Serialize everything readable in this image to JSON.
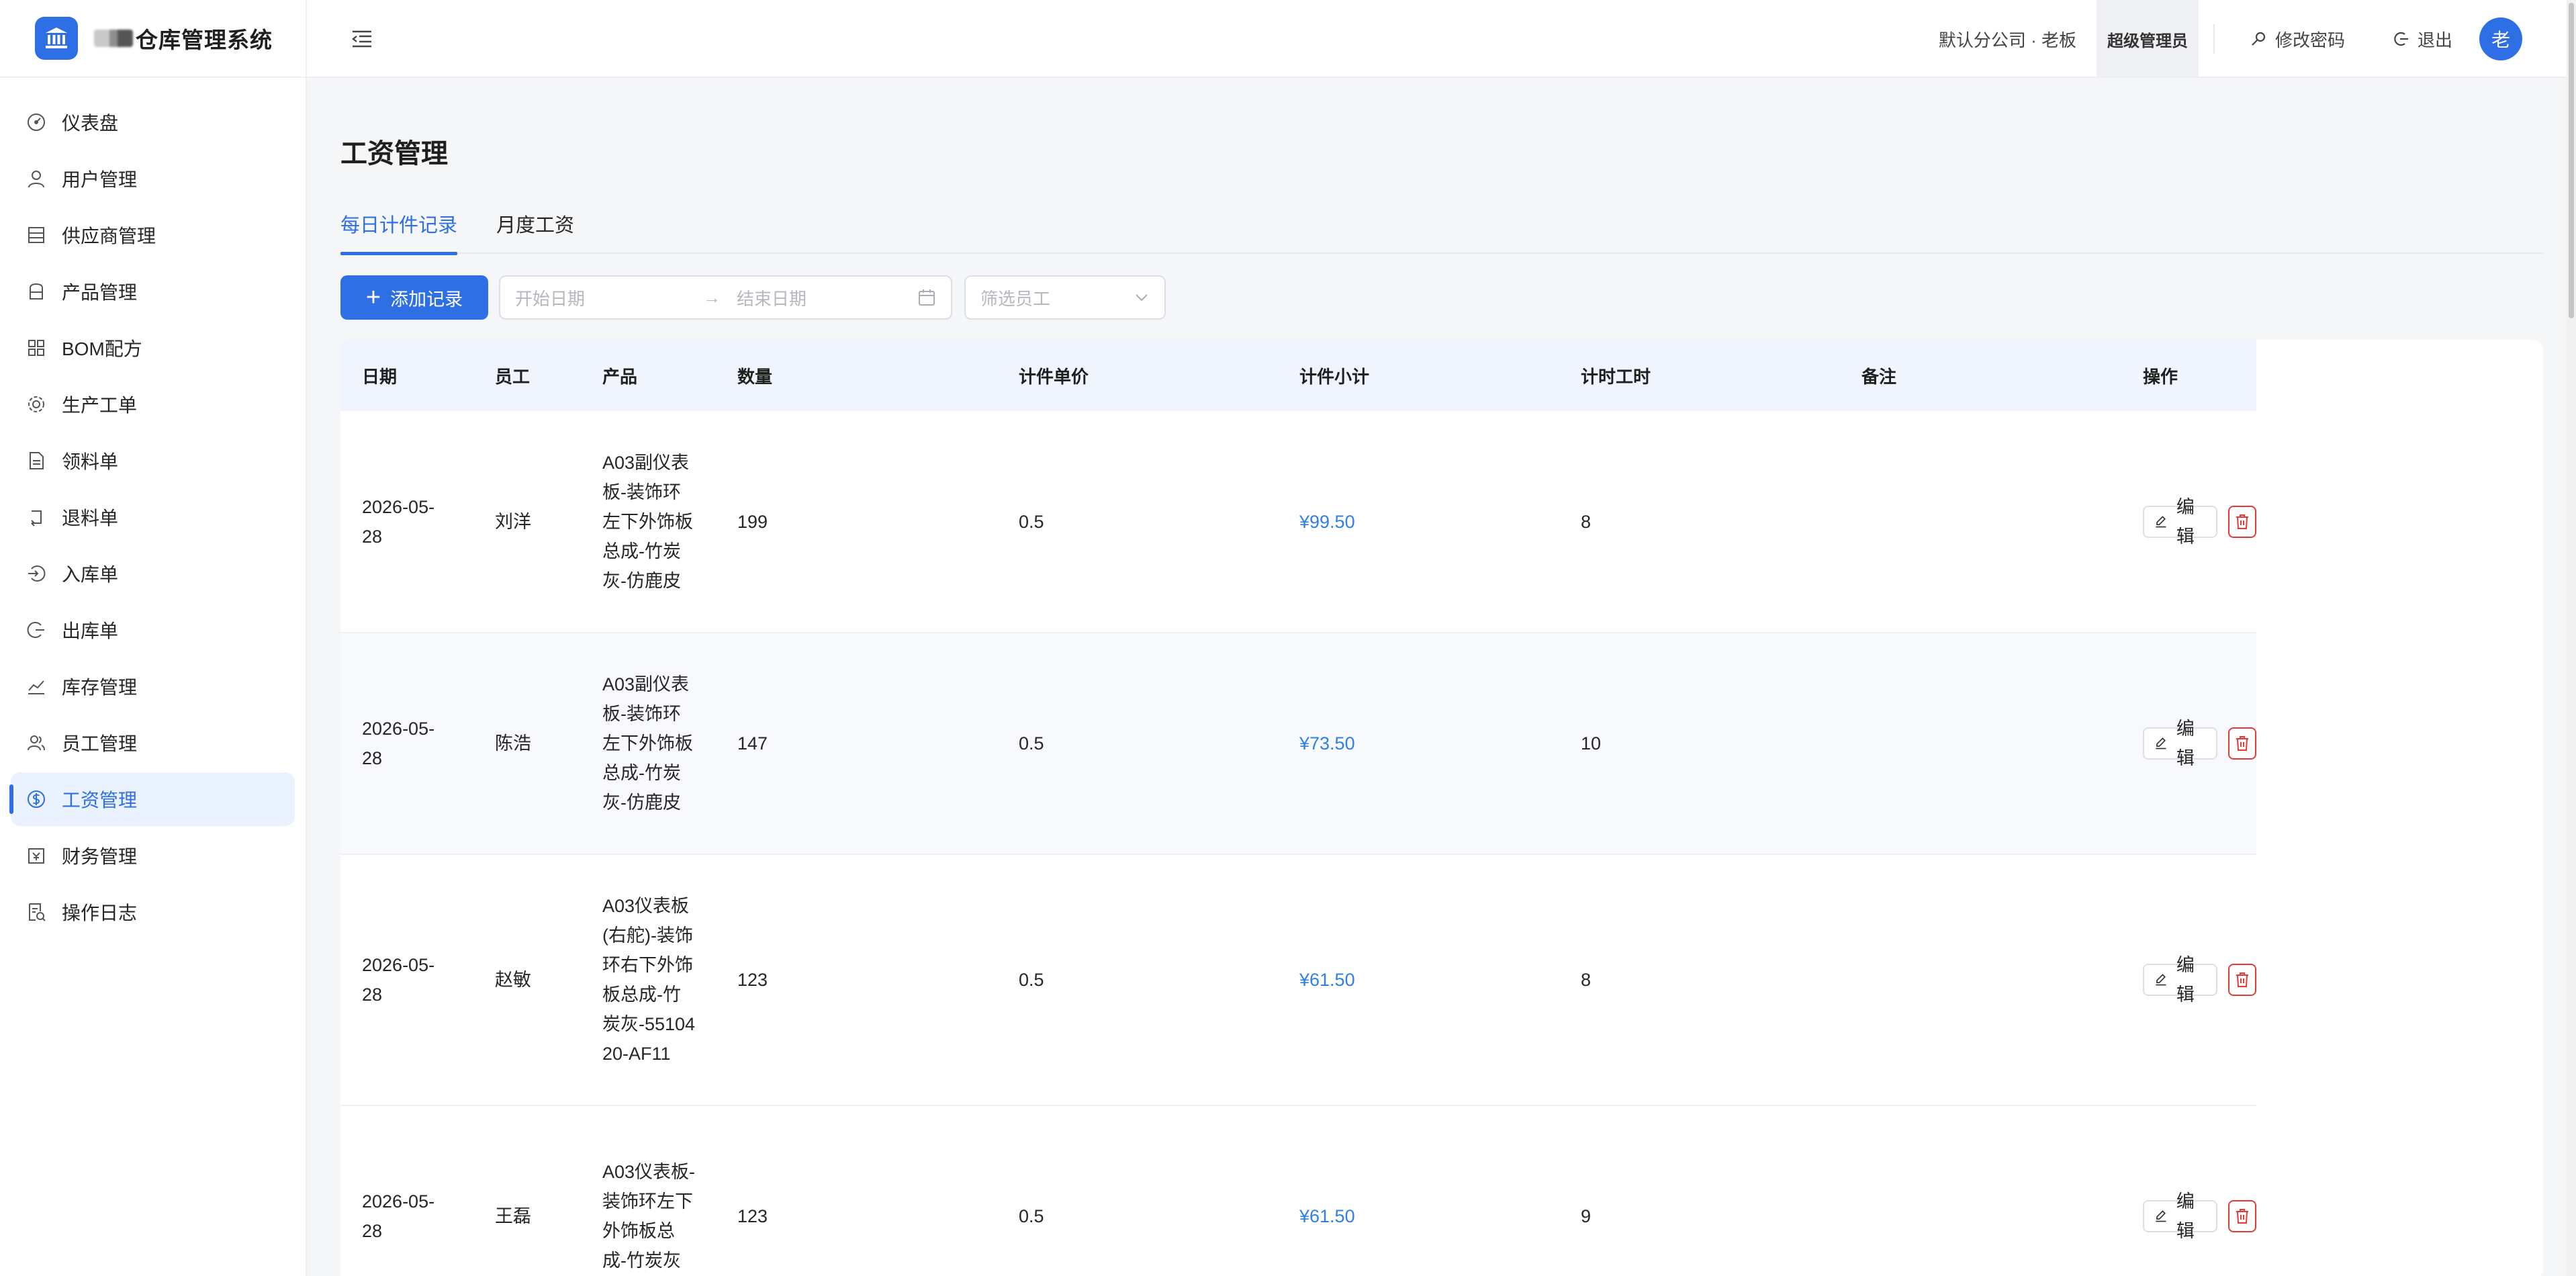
{
  "app": {
    "title": "仓库管理系统"
  },
  "sidebar": {
    "items": [
      {
        "label": "仪表盘",
        "icon": "dashboard-icon",
        "active": false
      },
      {
        "label": "用户管理",
        "icon": "user-icon",
        "active": false
      },
      {
        "label": "供应商管理",
        "icon": "store-icon",
        "active": false
      },
      {
        "label": "产品管理",
        "icon": "box-icon",
        "active": false
      },
      {
        "label": "BOM配方",
        "icon": "grid-icon",
        "active": false
      },
      {
        "label": "生产工单",
        "icon": "gear-icon",
        "active": false
      },
      {
        "label": "领料单",
        "icon": "document-icon",
        "active": false
      },
      {
        "label": "退料单",
        "icon": "return-icon",
        "active": false
      },
      {
        "label": "入库单",
        "icon": "login-icon",
        "active": false
      },
      {
        "label": "出库单",
        "icon": "logout-icon",
        "active": false
      },
      {
        "label": "库存管理",
        "icon": "line-chart-icon",
        "active": false
      },
      {
        "label": "员工管理",
        "icon": "team-icon",
        "active": false
      },
      {
        "label": "工资管理",
        "icon": "dollar-icon",
        "active": true
      },
      {
        "label": "财务管理",
        "icon": "account-book-icon",
        "active": false
      },
      {
        "label": "操作日志",
        "icon": "log-icon",
        "active": false
      }
    ]
  },
  "header": {
    "company": "默认分公司 · 老板",
    "role_badge": "超级管理员",
    "change_password": "修改密码",
    "logout": "退出",
    "avatar_text": "老"
  },
  "page": {
    "title": "工资管理",
    "tabs": [
      {
        "label": "每日计件记录",
        "active": true
      },
      {
        "label": "月度工资",
        "active": false
      }
    ],
    "toolbar": {
      "add_label": "添加记录",
      "start_placeholder": "开始日期",
      "end_placeholder": "结束日期",
      "employee_placeholder": "筛选员工"
    }
  },
  "table": {
    "columns": [
      "日期",
      "员工",
      "产品",
      "数量",
      "计件单价",
      "计件小计",
      "计时工时",
      "备注",
      "操作"
    ],
    "edit_label": "编辑",
    "rows": [
      {
        "date": "2026-05-28",
        "employee": "刘洋",
        "product": "A03副仪表板-装饰环左下外饰板总成-竹炭灰-仿鹿皮",
        "qty": "199",
        "unit_price": "0.5",
        "subtotal": "¥99.50",
        "hours": "8",
        "note": ""
      },
      {
        "date": "2026-05-28",
        "employee": "陈浩",
        "product": "A03副仪表板-装饰环左下外饰板总成-竹炭灰-仿鹿皮",
        "qty": "147",
        "unit_price": "0.5",
        "subtotal": "¥73.50",
        "hours": "10",
        "note": ""
      },
      {
        "date": "2026-05-28",
        "employee": "赵敏",
        "product": "A03仪表板(右舵)-装饰环右下外饰板总成-竹炭灰-5510420-AF11",
        "qty": "123",
        "unit_price": "0.5",
        "subtotal": "¥61.50",
        "hours": "8",
        "note": ""
      },
      {
        "date": "2026-05-28",
        "employee": "王磊",
        "product": "A03仪表板-装饰环左下外饰板总成-竹炭灰",
        "qty": "123",
        "unit_price": "0.5",
        "subtotal": "¥61.50",
        "hours": "9",
        "note": ""
      }
    ]
  }
}
